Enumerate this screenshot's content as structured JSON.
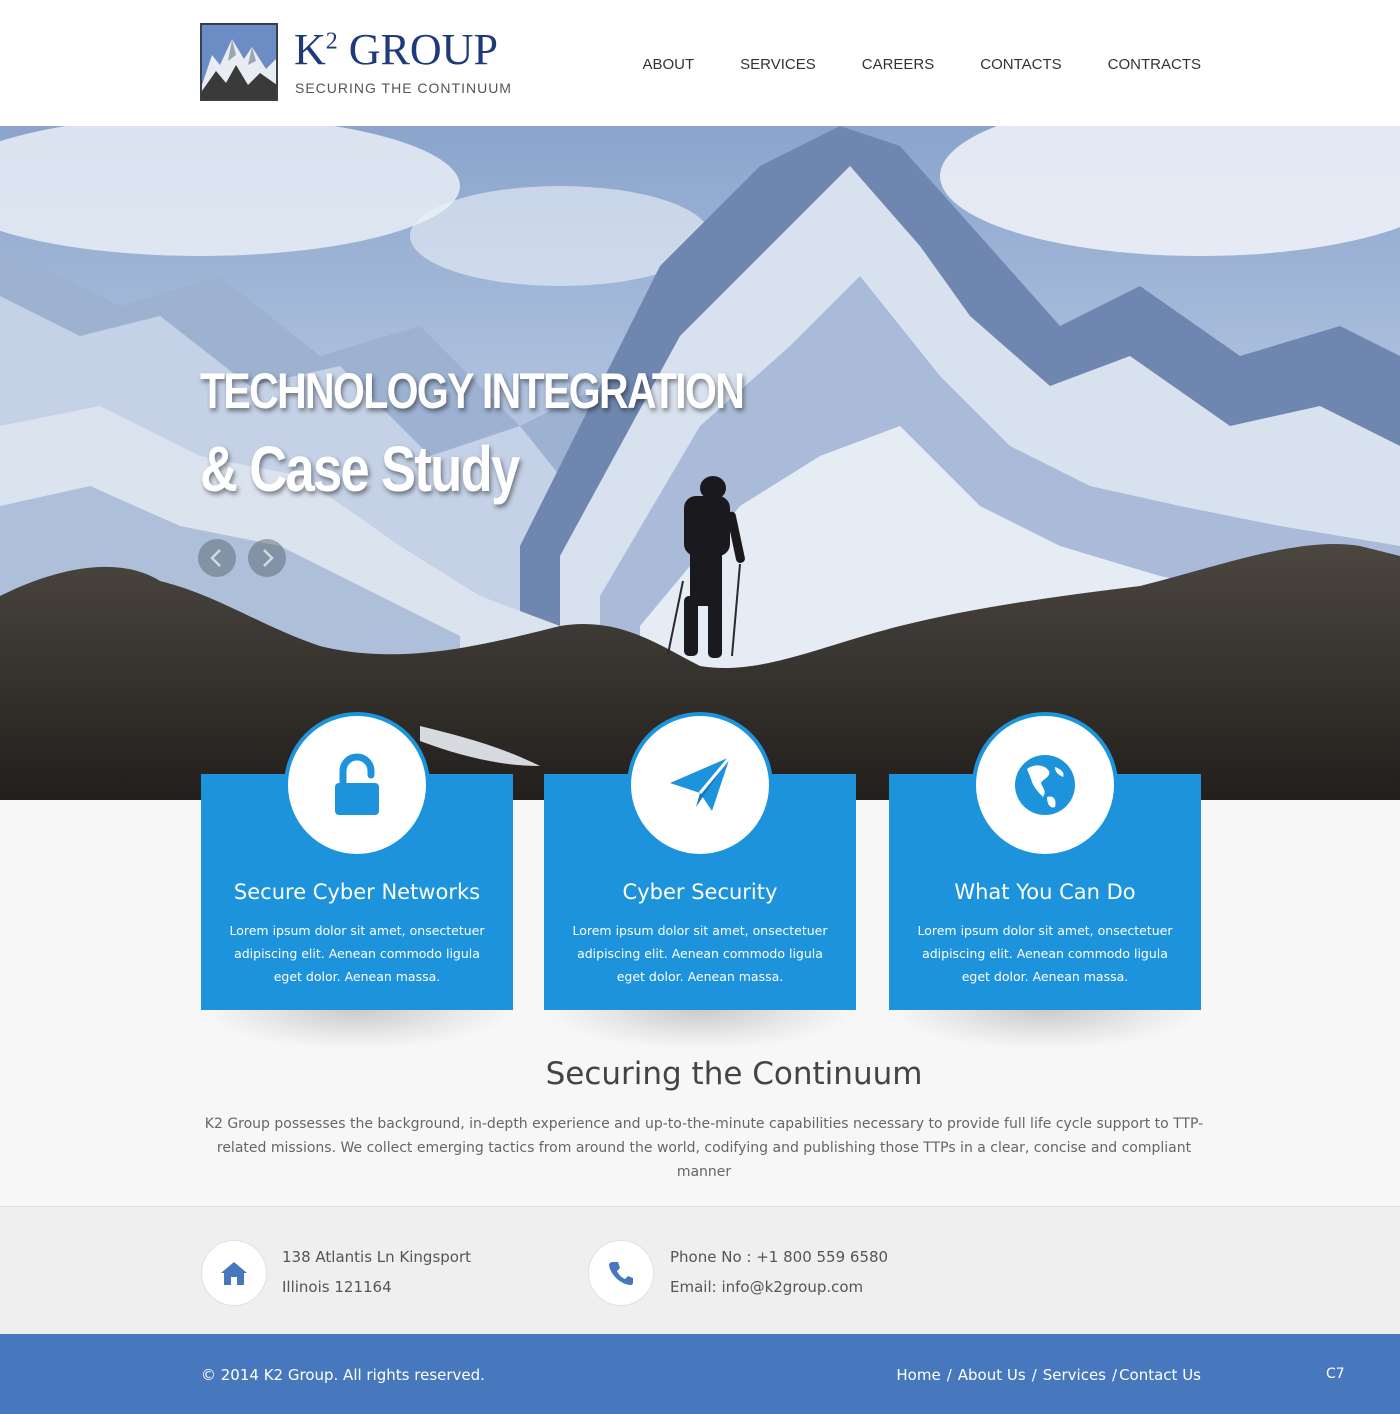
{
  "header": {
    "logo_title_main": "K",
    "logo_title_sup": "2",
    "logo_title_rest": " GROUP",
    "logo_subtitle": "SECURING THE CONTINUUM",
    "nav": [
      "ABOUT",
      "SERVICES",
      "CAREERS",
      "CONTACTS",
      "CONTRACTS"
    ]
  },
  "hero": {
    "title_line1": "TECHNOLOGY INTEGRATION",
    "title_line2": "& Case Study",
    "prev_icon": "chevron-left-icon",
    "next_icon": "chevron-right-icon"
  },
  "features": [
    {
      "icon": "unlock-icon",
      "title": "Secure Cyber Networks",
      "text": "Lorem ipsum dolor sit amet, onsectetuer adipiscing elit. Aenean commodo ligula eget dolor. Aenean massa."
    },
    {
      "icon": "paper-plane-icon",
      "title": "Cyber Security",
      "text": "Lorem ipsum dolor sit amet, onsectetuer adipiscing elit. Aenean commodo ligula eget dolor. Aenean massa."
    },
    {
      "icon": "globe-icon",
      "title": "What You Can Do",
      "text": "Lorem ipsum dolor sit amet, onsectetuer adipiscing elit. Aenean commodo ligula eget dolor. Aenean massa."
    }
  ],
  "intro": {
    "title": "Securing the Continuum",
    "text": "K2 Group possesses the background, in-depth experience and up-to-the-minute capabilities necessary to provide full life cycle support to TTP-related missions. We collect emerging tactics from around the world, codifying and publishing those TTPs in a clear, concise and compliant manner"
  },
  "contact": {
    "address_line1": "138 Atlantis Ln Kingsport",
    "address_line2": "Illinois 121164",
    "phone": "Phone No :  +1 800 559 6580",
    "email": "Email: info@k2group.com",
    "address_icon": "home-icon",
    "phone_icon": "phone-icon"
  },
  "footer": {
    "copyright": "© 2014 K2 Group. All rights reserved.",
    "links": [
      "Home",
      "About Us",
      "Services",
      "Contact Us"
    ],
    "code": "C7"
  },
  "colors": {
    "accent": "#1d93dc",
    "footer": "#4778bd",
    "brand": "#1e3a7a"
  }
}
